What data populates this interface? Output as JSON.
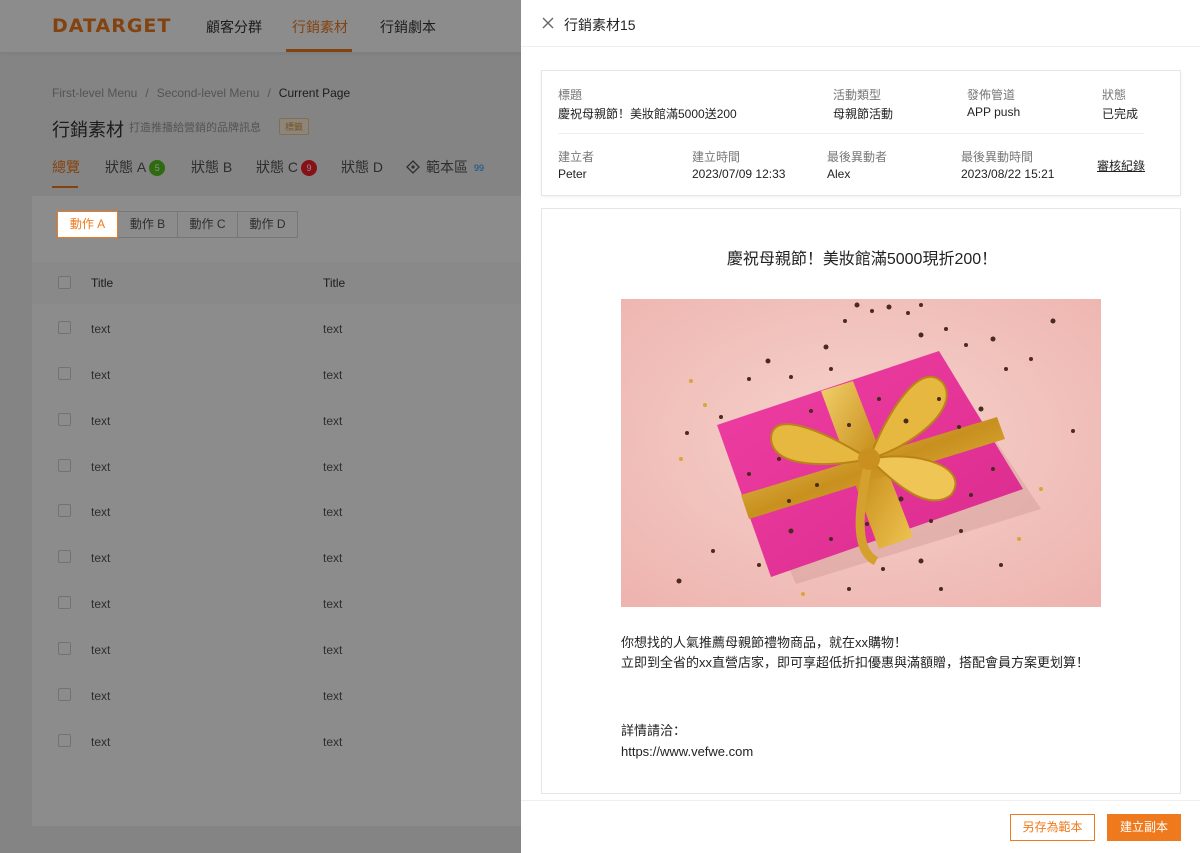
{
  "app": {
    "logo": "DATARGET",
    "nav": [
      "顧客分群",
      "行銷素材",
      "行銷劇本"
    ],
    "breadcrumb": [
      "First-level Menu",
      "Second-level Menu",
      "Current Page"
    ],
    "page_title": "行銷素材",
    "page_subtitle": "打造推播給營銷的品牌訊息",
    "page_tag": "標籤",
    "tabs": [
      {
        "label": "總覽",
        "badge": ""
      },
      {
        "label": "狀態 A",
        "badge": "5"
      },
      {
        "label": "狀態 B",
        "badge": ""
      },
      {
        "label": "狀態 C",
        "badge": "9"
      },
      {
        "label": "狀態 D",
        "badge": ""
      },
      {
        "label": "範本區",
        "badge": "99"
      }
    ],
    "actions": [
      "動作 A",
      "動作 B",
      "動作 C",
      "動作 D"
    ],
    "table": {
      "headers": [
        "Title",
        "Title"
      ],
      "rows": [
        [
          "text",
          "text"
        ],
        [
          "text",
          "text"
        ],
        [
          "text",
          "text"
        ],
        [
          "text",
          "text"
        ],
        [
          "text",
          "text"
        ],
        [
          "text",
          "text"
        ],
        [
          "text",
          "text"
        ],
        [
          "text",
          "text"
        ],
        [
          "text",
          "text"
        ],
        [
          "text",
          "text"
        ]
      ]
    }
  },
  "drawer": {
    "title": "行銷素材15",
    "info": {
      "title_label": "標題",
      "title_value": "慶祝母親節！美妝館滿5000送200",
      "type_label": "活動類型",
      "type_value": "母親節活動",
      "channel_label": "發佈管道",
      "channel_value": "APP push",
      "status_label": "狀態",
      "status_value": "已完成",
      "creator_label": "建立者",
      "creator_value": "Peter",
      "created_label": "建立時間",
      "created_value": "2023/07/09 12:33",
      "modifier_label": "最後異動者",
      "modifier_value": "Alex",
      "modified_label": "最後異動時間",
      "modified_value": "2023/08/22 15:21",
      "audit_link": "審核紀錄"
    },
    "preview": {
      "headline": "慶祝母親節！美妝館滿5000現折200！",
      "body_line1": "你想找的人氣推薦母親節禮物商品，就在xx購物！",
      "body_line2": "立即到全省的xx直營店家，即可享超低折扣優惠與滿額贈，搭配會員方案更划算！",
      "contact_label": "詳情請洽：",
      "contact_url": "https://www.vefwe.com"
    },
    "footer": {
      "save_template": "另存為範本",
      "create_copy": "建立副本"
    }
  },
  "colors": {
    "accent": "#ef7a1e",
    "gift_pink": "#e8349a",
    "ribbon_gold": "#e0b23a",
    "background_pink": "#f3c3bf"
  }
}
